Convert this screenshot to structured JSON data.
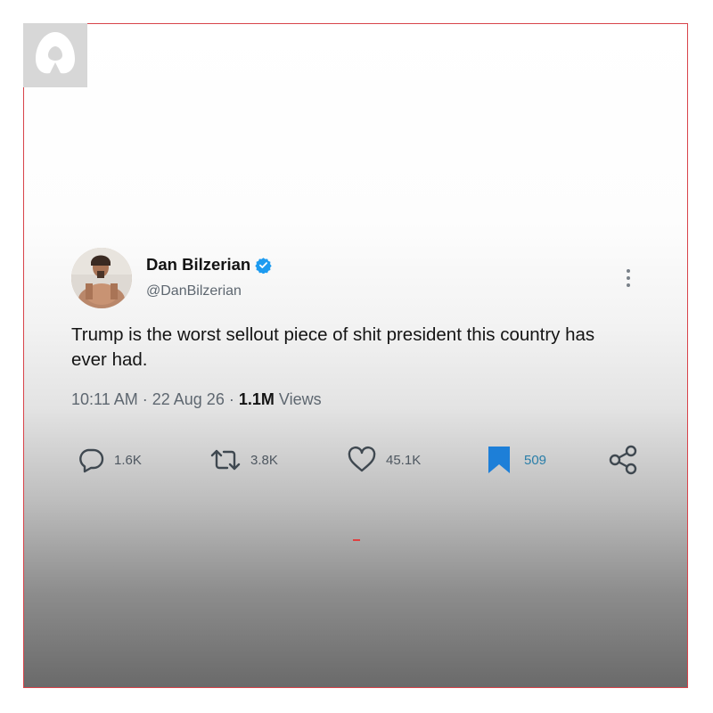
{
  "tweet": {
    "display_name": "Dan Bilzerian",
    "handle": "@DanBilzerian",
    "text": "Trump is the worst sellout piece of shit president this country has ever had.",
    "time": "10:11 AM",
    "separator": "·",
    "date": "22 Aug 26",
    "views_count": "1.1M",
    "views_label": "Views",
    "verified": true
  },
  "actions": {
    "replies": "1.6K",
    "retweets": "3.8K",
    "likes": "45.1K",
    "bookmarks": "509"
  },
  "icons": {
    "reply": "speech-bubble-icon",
    "retweet": "retweet-arrows-icon",
    "like": "heart-icon",
    "bookmark": "bookmark-icon",
    "share": "share-icon",
    "more": "vertical-dots-icon",
    "verified": "verified-badge-icon"
  },
  "colors": {
    "verified_badge": "#1d9bf0",
    "bookmark_active": "#1d7fd8",
    "frame_border": "#d8434a",
    "accent_mark": "#e04040"
  }
}
